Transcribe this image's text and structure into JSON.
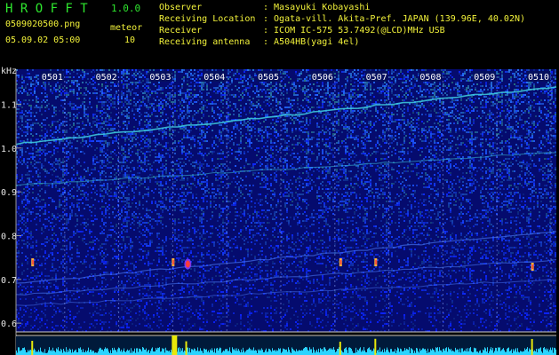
{
  "app": {
    "title": "H R O F F T",
    "version": "1.0.0"
  },
  "file": {
    "name": "0509020500.png",
    "datetime": "05.09.02 05:00"
  },
  "meteor": {
    "label": "meteor",
    "count": "10"
  },
  "station": [
    {
      "key": "Observer",
      "value": ": Masayuki Kobayashi"
    },
    {
      "key": "Receiving Location",
      "value": ": Ogata-vill. Akita-Pref. JAPAN (139.96E, 40.02N)"
    },
    {
      "key": "Receiver",
      "value": ": ICOM IC-575 53.7492(@LCD)MHz USB"
    },
    {
      "key": "Receiving antenna",
      "value": ": A504HB(yagi 4el)"
    }
  ],
  "chart_data": {
    "type": "heatmap",
    "title": "",
    "ylabel": "kHz",
    "xlabel": "",
    "x_ticks": [
      "0501",
      "0502",
      "0503",
      "0504",
      "0505",
      "0506",
      "0507",
      "0508",
      "0509",
      "0510"
    ],
    "y_ticks": [
      "1.1",
      "1.0",
      "0.9",
      "0.8",
      "0.7",
      "0.6"
    ],
    "y_tick_values": [
      1.1,
      1.0,
      0.9,
      0.8,
      0.7,
      0.6
    ],
    "ylim": [
      0.58,
      1.18
    ],
    "grid": true,
    "meteor_times": [
      0.3,
      2.9,
      6.0,
      6.65,
      9.55
    ],
    "meteor_freqs": [
      0.74,
      0.74,
      0.74,
      0.74,
      0.73
    ],
    "meteor_count_peaks": [
      0.3,
      2.9,
      3.15,
      6.0,
      6.65,
      9.55
    ]
  },
  "colors": {
    "background": "#000000",
    "noise_low": "#050b6e",
    "noise_high": "#2a5cff",
    "trace": "#3fd0e0",
    "meteor": "#ff3a3a",
    "count_bar": "#2ad4ff",
    "count_peak": "#e8e80a",
    "grid": "#9a9a9a"
  }
}
